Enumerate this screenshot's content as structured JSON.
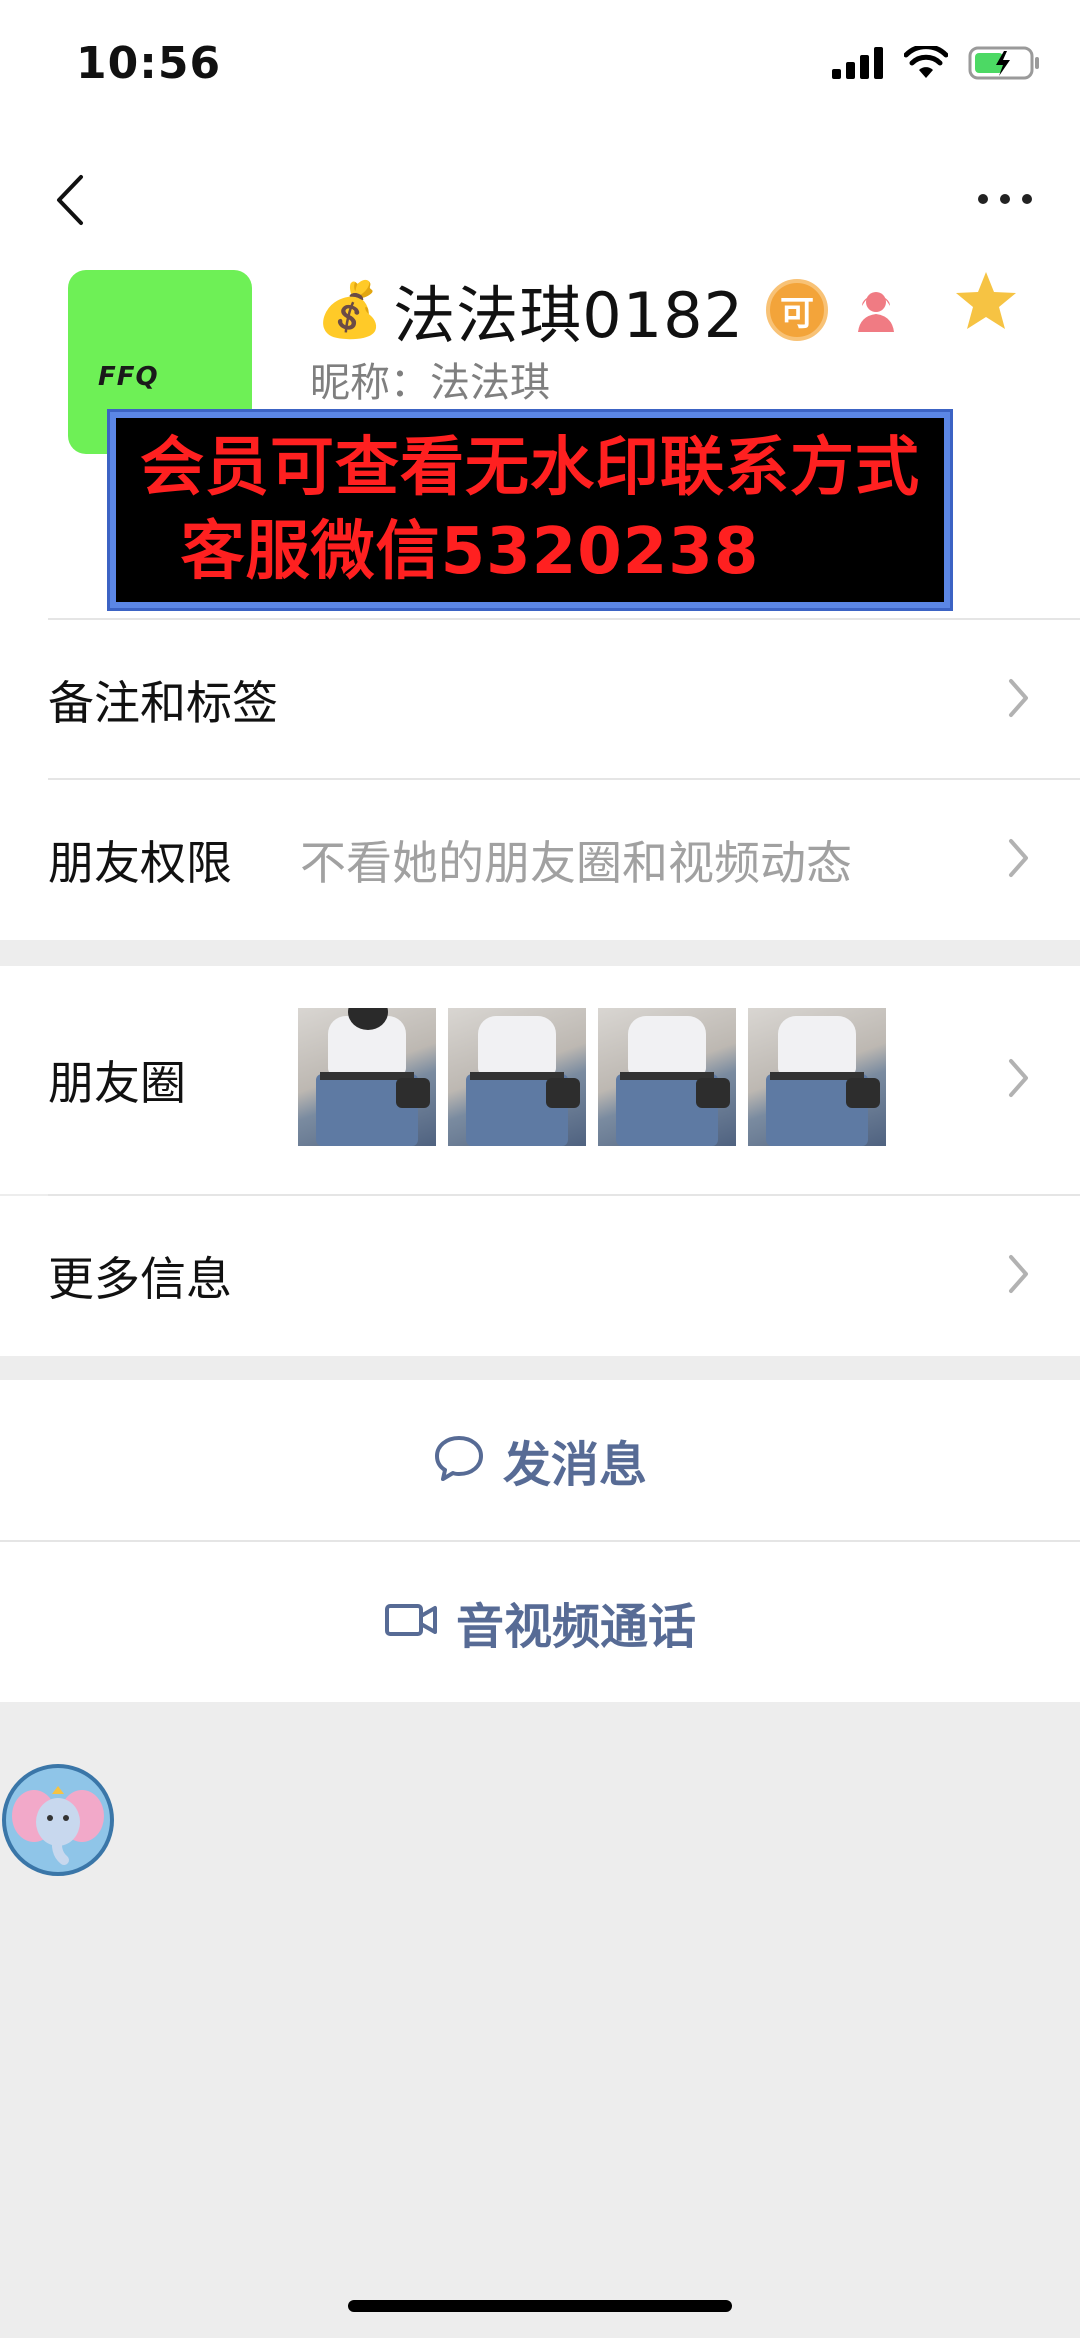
{
  "status_bar": {
    "time": "10:56",
    "icons": [
      "signal-icon",
      "wifi-icon",
      "battery-icon"
    ]
  },
  "header": {
    "back_icon": "chevron-left-icon",
    "more_icon": "ellipsis-icon"
  },
  "profile": {
    "avatar_text": "FFQ",
    "avatar_color": "#6ef056",
    "name_emoji": "💰",
    "name": "法法琪0182",
    "badge_text": "可",
    "nickname": "昵称：法法琪",
    "star_color": "#f6c343"
  },
  "watermark": {
    "line1": "会员可查看无水印联系方式",
    "line2": "客服微信5320238"
  },
  "settings": {
    "remarks_label": "备注和标签",
    "permissions_label": "朋友权限",
    "permissions_value": "不看她的朋友圈和视频动态",
    "moments_label": "朋友圈",
    "more_info_label": "更多信息"
  },
  "actions": {
    "message_label": "发消息",
    "call_label": "音视频通话",
    "accent_color": "#576b95"
  }
}
